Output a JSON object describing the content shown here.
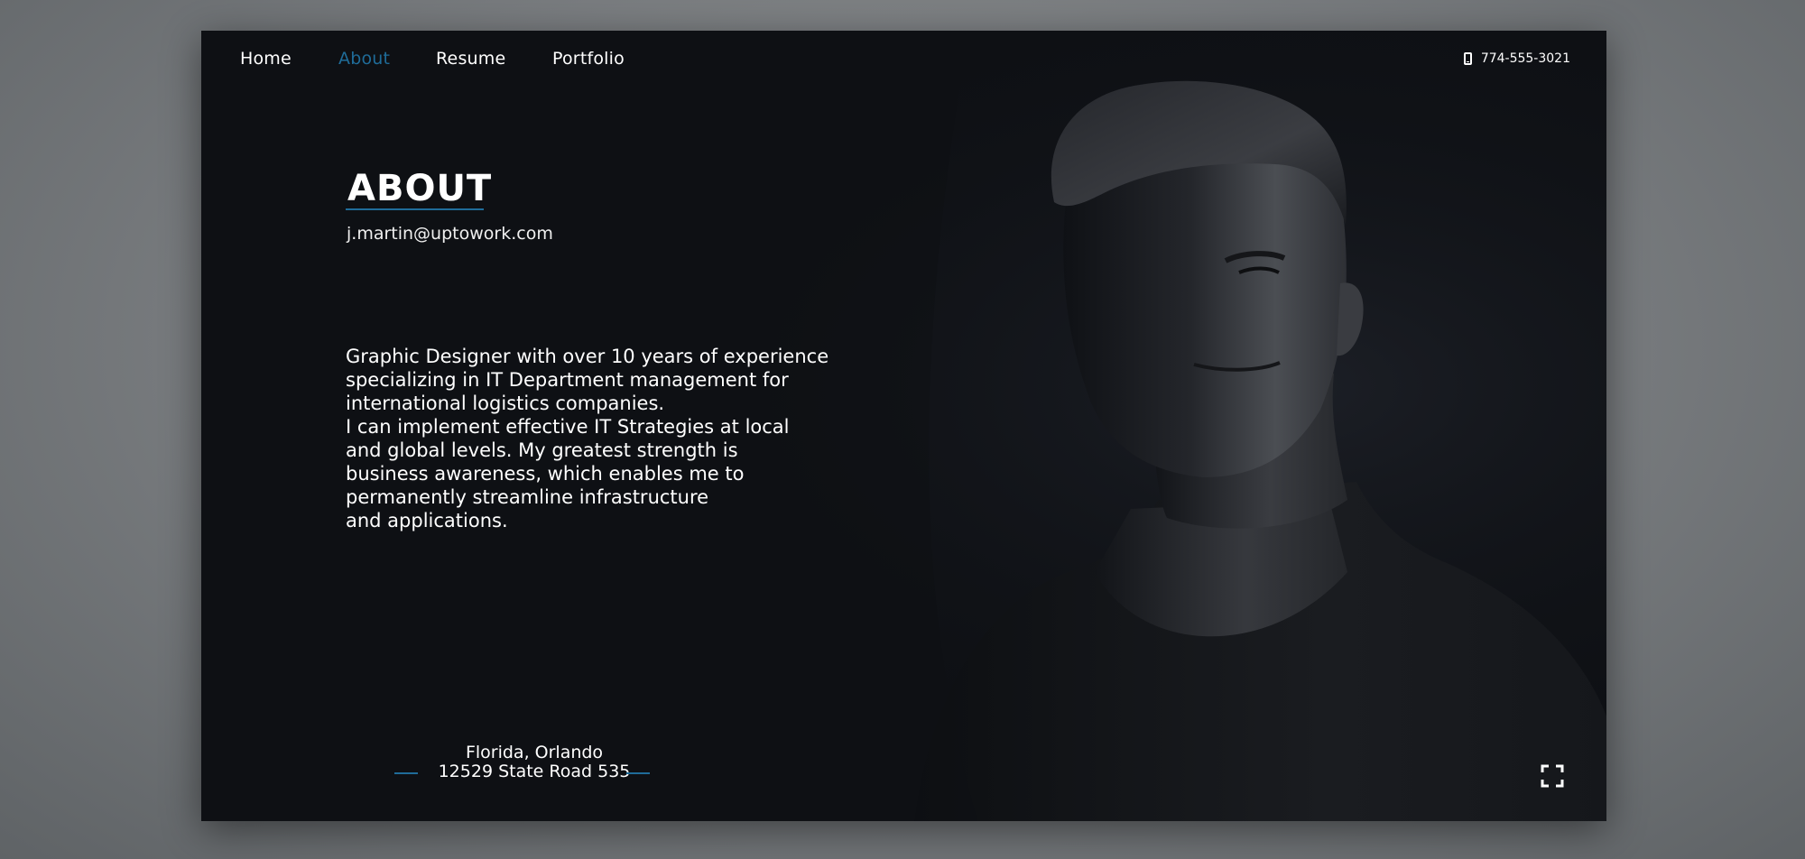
{
  "nav": {
    "items": [
      {
        "label": "Home",
        "active": false
      },
      {
        "label": "About",
        "active": true
      },
      {
        "label": "Resume",
        "active": false
      },
      {
        "label": "Portfolio",
        "active": false
      }
    ],
    "phone": "774-555-3021"
  },
  "about": {
    "title": "ABOUT",
    "email": "j.martin@uptowork.com",
    "bio": [
      "Graphic Designer with over 10 years of experience",
      "specializing in IT Department management for",
      "international logistics companies.",
      "I can implement effective IT Strategies at local",
      "and global levels. My greatest strength is",
      "business awareness, which enables me to",
      "permanently streamline infrastructure",
      "and applications."
    ]
  },
  "address": {
    "line1": "Florida, Orlando",
    "line2": "12529 State Road 535"
  },
  "icons": {
    "phone": "mobile-phone-icon",
    "fullscreen": "fullscreen-icon"
  },
  "colors": {
    "accent": "#1f6c99",
    "background": "#0e1014",
    "text": "#ffffff"
  }
}
